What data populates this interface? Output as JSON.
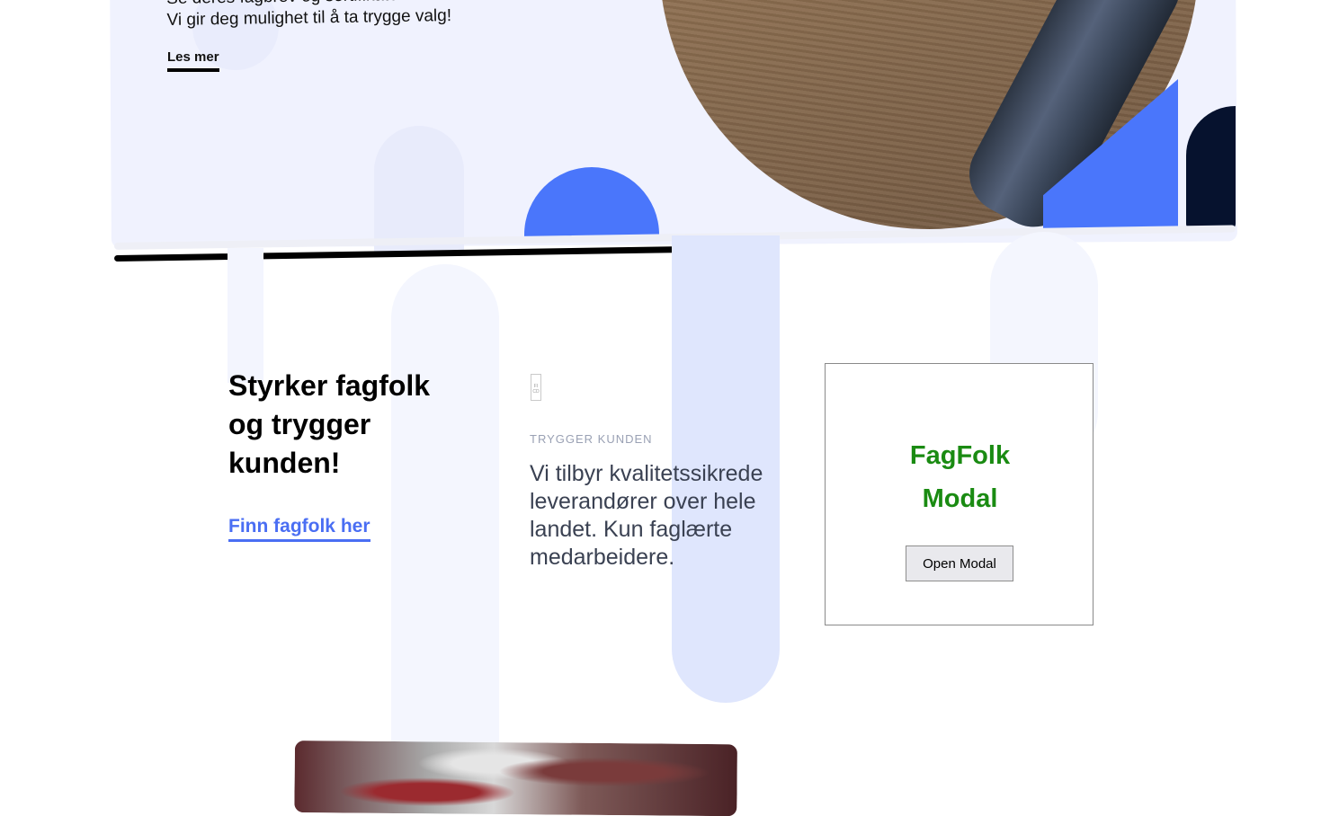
{
  "hero": {
    "text_line_1": "Se deres fagbrev og sertifikater.",
    "text_line_2": "Vi gir deg mulighet til å ta trygge valg!",
    "read_more_label": "Les mer"
  },
  "progress": {
    "value": 0.5
  },
  "main": {
    "headline_line_1": "Styrker fagfolk",
    "headline_line_2": "og trygger",
    "headline_line_3": "kunden!",
    "find_link_label": "Finn fagfolk her",
    "logo_text": "FI CD",
    "eyebrow": "TRYGGER KUNDEN",
    "body_line_1": "Vi tilbyr kvalitetssikrede",
    "body_line_2": "leverandører over hele",
    "body_line_3": "landet. Kun faglærte",
    "body_line_4": "medarbeidere."
  },
  "modal_card": {
    "title_line_1": "FagFolk",
    "title_line_2": "Modal",
    "open_button_label": "Open Modal"
  },
  "colors": {
    "accent_blue": "#4a76fb",
    "navy": "#06122e",
    "modal_title_green": "#1a8b12",
    "link_blue": "#4a6ef3"
  }
}
